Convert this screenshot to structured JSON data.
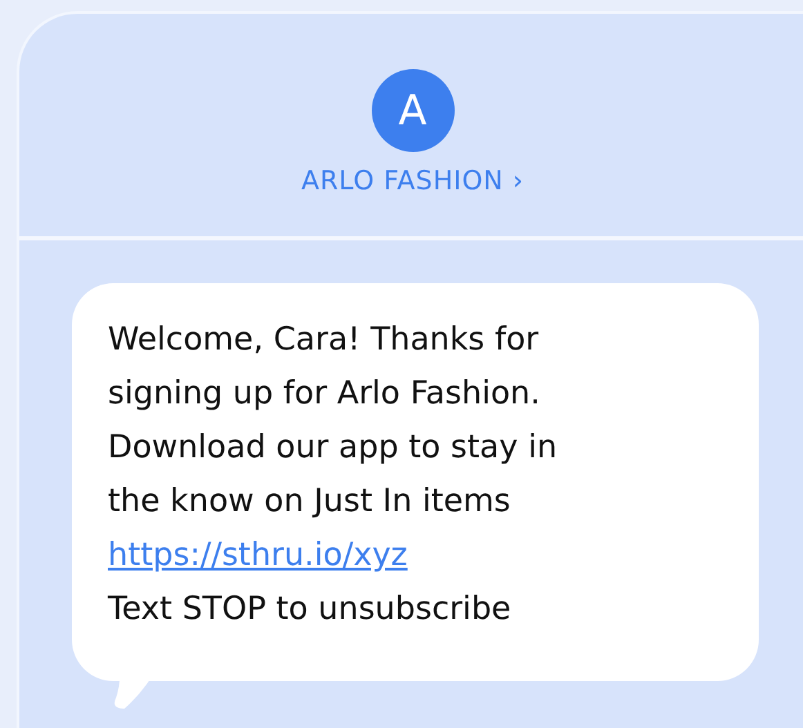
{
  "sender": {
    "initial": "A",
    "name": "ARLO FASHION ›"
  },
  "message": {
    "lines": [
      "Welcome, Cara! Thanks for",
      "signing up for Arlo Fashion.",
      "Download our app to stay in",
      "the know on Just In items"
    ],
    "link": "https://sthru.io/xyz",
    "footer": "Text STOP to unsubscribe"
  }
}
